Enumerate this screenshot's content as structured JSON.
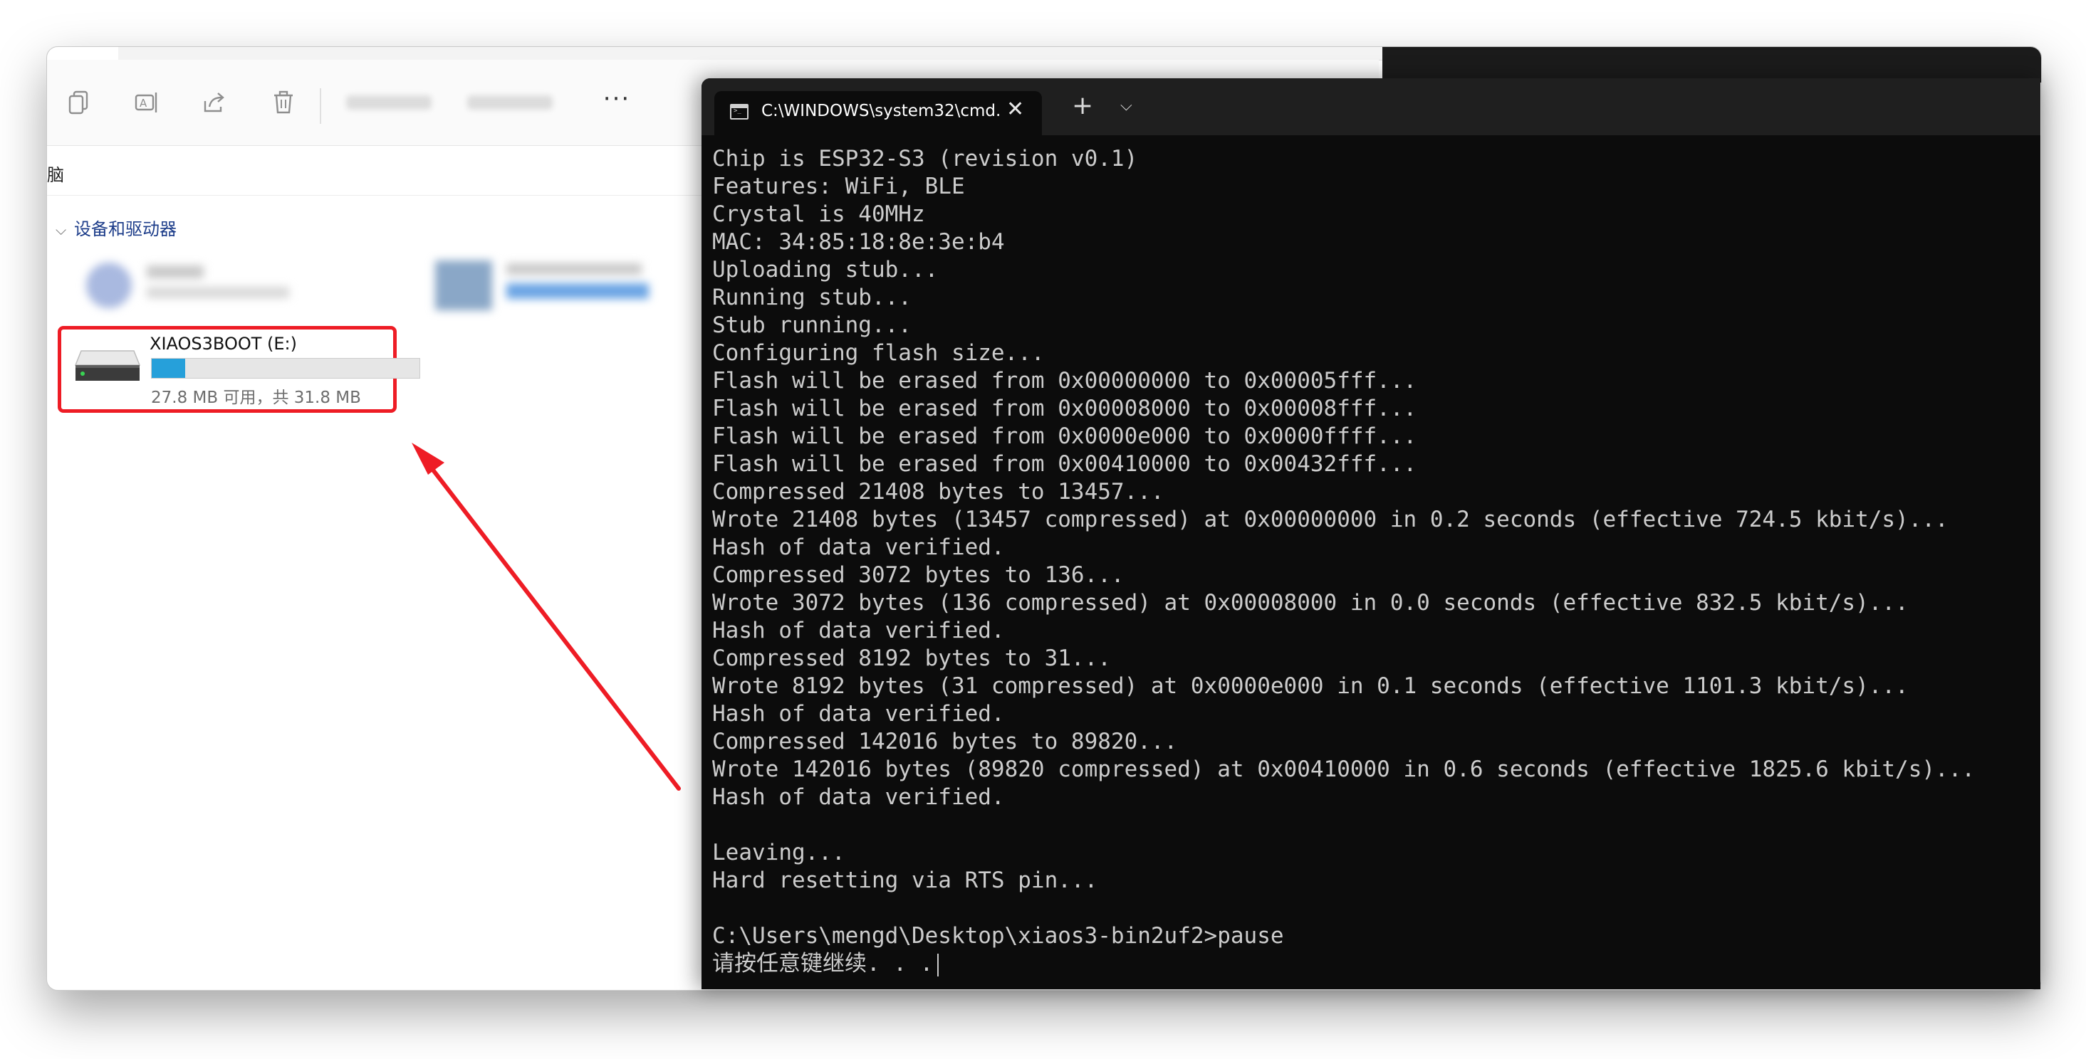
{
  "explorer": {
    "address": "脑",
    "group_header": "设备和驱动器",
    "toolbar_icons": [
      "copy-icon",
      "rename-icon",
      "share-icon",
      "delete-icon"
    ],
    "more_label": "···",
    "drive": {
      "name": "XIAOS3BOOT (E:)",
      "free_text": "27.8 MB 可用，共 31.8 MB",
      "used_fraction": 0.126,
      "bar_color": "#26a0da"
    },
    "highlight_color": "#ee1c25"
  },
  "terminal": {
    "tab_title": "C:\\WINDOWS\\system32\\cmd.",
    "close_glyph": "✕",
    "new_tab_glyph": "+",
    "dropdown_glyph": "⌵",
    "lines": [
      "Chip is ESP32-S3 (revision v0.1)",
      "Features: WiFi, BLE",
      "Crystal is 40MHz",
      "MAC: 34:85:18:8e:3e:b4",
      "Uploading stub...",
      "Running stub...",
      "Stub running...",
      "Configuring flash size...",
      "Flash will be erased from 0x00000000 to 0x00005fff...",
      "Flash will be erased from 0x00008000 to 0x00008fff...",
      "Flash will be erased from 0x0000e000 to 0x0000ffff...",
      "Flash will be erased from 0x00410000 to 0x00432fff...",
      "Compressed 21408 bytes to 13457...",
      "Wrote 21408 bytes (13457 compressed) at 0x00000000 in 0.2 seconds (effective 724.5 kbit/s)...",
      "Hash of data verified.",
      "Compressed 3072 bytes to 136...",
      "Wrote 3072 bytes (136 compressed) at 0x00008000 in 0.0 seconds (effective 832.5 kbit/s)...",
      "Hash of data verified.",
      "Compressed 8192 bytes to 31...",
      "Wrote 8192 bytes (31 compressed) at 0x0000e000 in 0.1 seconds (effective 1101.3 kbit/s)...",
      "Hash of data verified.",
      "Compressed 142016 bytes to 89820...",
      "Wrote 142016 bytes (89820 compressed) at 0x00410000 in 0.6 seconds (effective 1825.6 kbit/s)...",
      "Hash of data verified.",
      "",
      "Leaving...",
      "Hard resetting via RTS pin...",
      "",
      "C:\\Users\\mengd\\Desktop\\xiaos3-bin2uf2>pause",
      "请按任意键继续. . ."
    ]
  }
}
